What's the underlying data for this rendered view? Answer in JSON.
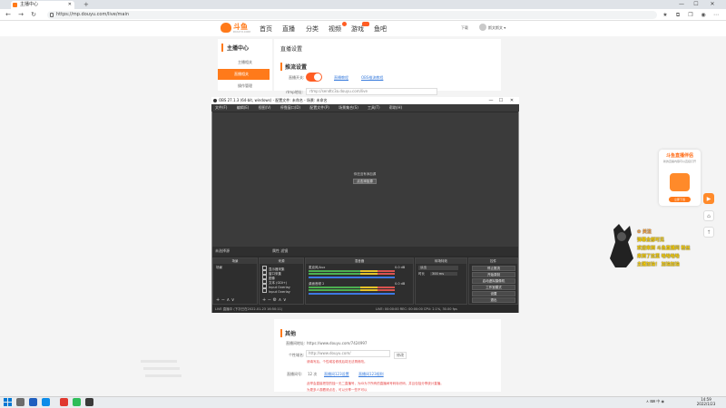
{
  "browser": {
    "tab_title": "主播中心",
    "new_tab": "+",
    "url": "https://mp.douyu.com/live/main",
    "win_min": "—",
    "win_max": "☐",
    "win_close": "✕"
  },
  "site": {
    "logo_text": "斗鱼",
    "logo_sub": "DOUYU.COM",
    "nav": [
      "首页",
      "直播",
      "分类",
      "视频",
      "游戏",
      "鱼吧"
    ],
    "download_label": "下载",
    "username": "斯文斯文 ▾"
  },
  "sidebar": {
    "title": "主播中心",
    "items": [
      "主播相关",
      "直播相关",
      "操作管理"
    ]
  },
  "main": {
    "title": "直播设置",
    "section1": "推流设置",
    "toggle_label": "直播开关:",
    "link1": "直播教程",
    "link2": "OBS推流教程",
    "rtmp_label": "rtmp地址:",
    "rtmp_value": "rtmp://sendtc3a.douyu.com/live"
  },
  "obs": {
    "title": "OBS 27.1.3 (64-bit, windows) - 配置文件: 未命名 - 场景: 未命名",
    "menu": [
      "文件(F)",
      "编辑(E)",
      "视图(V)",
      "停靠窗口(D)",
      "配置文件(P)",
      "场景集合(S)",
      "工具(T)",
      "帮助(H)"
    ],
    "no_source": "你还没有添加源",
    "add_source": "点击添加源",
    "no_source_selected": "未选择源",
    "props_btn": "属性",
    "filters_btn": "滤镜",
    "docks": {
      "scenes": "场景",
      "sources": "来源",
      "mixer": "混音器",
      "transitions": "转场特效",
      "controls": "控件"
    },
    "scene_item": "场景",
    "source_items": [
      "显示器采集",
      "窗口采集",
      "图像",
      "文本 (GDI+)",
      "Input Overlay",
      "Input Overlay"
    ],
    "mixer_tracks": [
      {
        "name": "麦克风/Aux",
        "db": "0.0 dB"
      },
      {
        "name": "桌面音频 2",
        "db": "0.0 dB"
      }
    ],
    "transition_type": "淡出",
    "duration_label": "时长",
    "duration_value": "300 ms",
    "controls": [
      "停止推流",
      "开始录制",
      "启动虚拟摄像机",
      "工作室模式",
      "设置",
      "退出"
    ],
    "bottom_left": "LIVE 直播中 (下次已在2022-01-23 16:50:11)",
    "bottom_right": "LIVE: 00:00:00   REC: 00:00:00   CPU: 2.1%, 30.00 fps"
  },
  "lower": {
    "section": "其他",
    "share_label": "直播间地址:",
    "share_value": "https://www.douyu.com/7424997",
    "personal_label": "个性域名:",
    "personal_value": "http://www.douyu.com/",
    "personal_btn": "修改",
    "personal_err": "请填写后，个性域名修改后将无法再修改。",
    "viewer_label": "直播间号:",
    "viewer_value": "12 次",
    "link1": "直播间123设置",
    "link2": "直播间123规则",
    "notice1": "此举会直接把您的独一无二直播号，为ID为下所有的直播间号码标识码，并且包括分享统计直播。",
    "notice2": "为更多人观看请点击，可以分享一些不可以"
  },
  "widget": {
    "title": "斗鱼直播伴侣",
    "subtitle": "新的直播内容可以直接打开",
    "button": "立即下载"
  },
  "chat": [
    {
      "text": "✿ 关注",
      "color": "#ff9f2f"
    },
    {
      "text": "弹幕全部可见",
      "color": "#ffd400"
    },
    {
      "text": "欢迎来到 斗鱼直播间 粉丝",
      "color": "#ffd400"
    },
    {
      "text": "来到了这里 哈哈哈哈",
      "color": "#ffd400"
    },
    {
      "text": "主播加油！ 加油加油",
      "color": "#ffd400"
    }
  ],
  "taskbar": {
    "tray": "∧ ⌨ 中 ◉",
    "time": "14:59",
    "date": "2022/1/23"
  },
  "colors": {
    "brand": "#ff7a1a",
    "link": "#3b7ddd",
    "error": "#e64545"
  }
}
